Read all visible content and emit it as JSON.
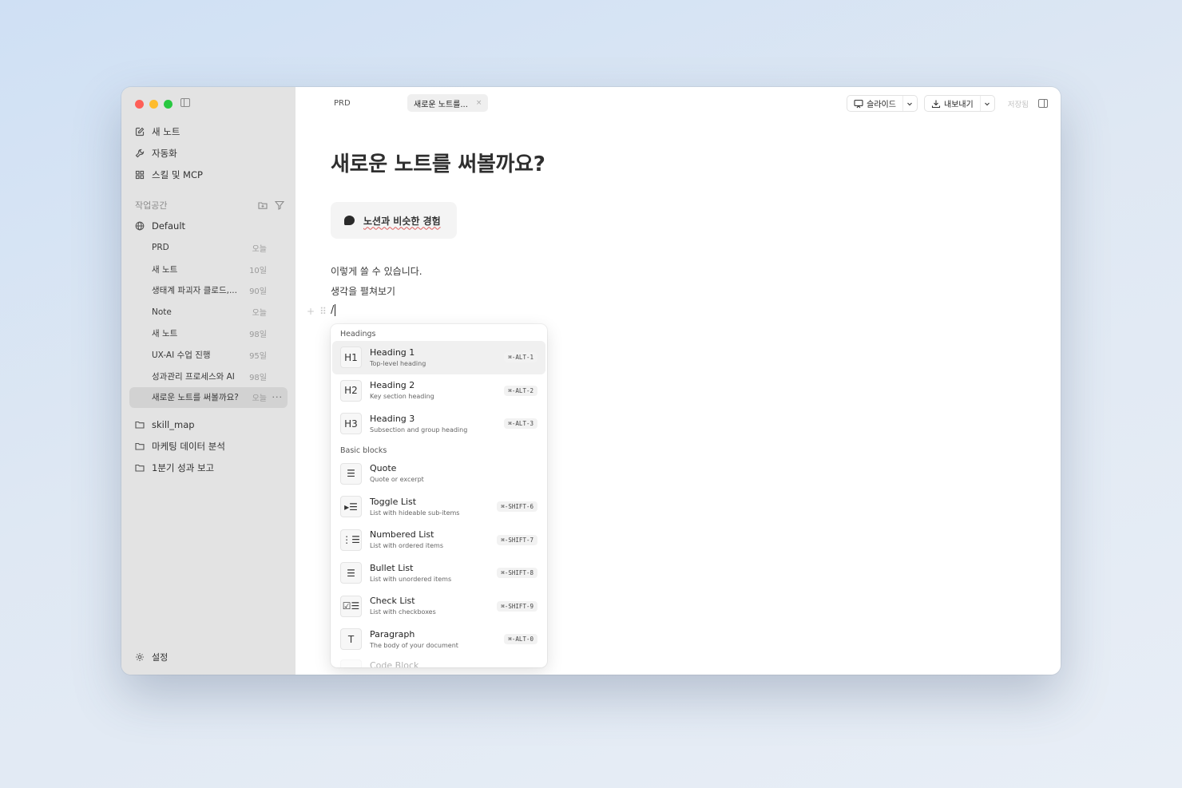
{
  "sidebar": {
    "nav": [
      {
        "label": "새 노트",
        "icon": "edit-icon"
      },
      {
        "label": "자동화",
        "icon": "wrench-icon"
      },
      {
        "label": "스킬 및 MCP",
        "icon": "grid-icon"
      }
    ],
    "section_label": "작업공간",
    "workspace": {
      "label": "Default",
      "icon": "globe-icon"
    },
    "docs": [
      {
        "title": "PRD",
        "date": "오늘"
      },
      {
        "title": "새 노트",
        "date": "10일"
      },
      {
        "title": "생태계 파괴자 클로드,...",
        "date": "90일"
      },
      {
        "title": "Note",
        "date": "오늘"
      },
      {
        "title": "새 노트",
        "date": "98일"
      },
      {
        "title": "UX-AI 수업 진행",
        "date": "95일"
      },
      {
        "title": "성과관리 프로세스와 AI",
        "date": "98일"
      },
      {
        "title": "새로운 노트를 써볼까요?",
        "date": "오늘"
      }
    ],
    "more_glyph": "···",
    "folders": [
      {
        "label": "skill_map"
      },
      {
        "label": "마케팅 데이터 분석"
      },
      {
        "label": "1분기 성과 보고"
      }
    ],
    "settings_label": "설정"
  },
  "tabs": {
    "inactive_label": "PRD",
    "active_label": "새로운 노트를...",
    "close_glyph": "×"
  },
  "toolbar": {
    "slide_label": "슬라이드",
    "export_label": "내보내기",
    "save_status": "저장됨"
  },
  "editor": {
    "title": "새로운 노트를 써볼까요?",
    "callout_text": "노션과 비슷한 경험",
    "line1": "이렇게 쓸 수 있습니다.",
    "line2": "생각을 펼쳐보기",
    "slash_input": "/",
    "add_glyph": "+",
    "drag_glyph": "⠿"
  },
  "slash_menu": {
    "section_headings": "Headings",
    "section_basic": "Basic blocks",
    "headings": [
      {
        "icon": "H1",
        "title": "Heading 1",
        "sub": "Top-level heading",
        "shortcut": "⌘-ALT-1"
      },
      {
        "icon": "H2",
        "title": "Heading 2",
        "sub": "Key section heading",
        "shortcut": "⌘-ALT-2"
      },
      {
        "icon": "H3",
        "title": "Heading 3",
        "sub": "Subsection and group heading",
        "shortcut": "⌘-ALT-3"
      }
    ],
    "basic": [
      {
        "icon": "quote-icon",
        "glyph": "☰",
        "title": "Quote",
        "sub": "Quote or excerpt",
        "shortcut": ""
      },
      {
        "icon": "toggle-list-icon",
        "glyph": "▸☰",
        "title": "Toggle List",
        "sub": "List with hideable sub-items",
        "shortcut": "⌘-SHIFT-6"
      },
      {
        "icon": "numbered-list-icon",
        "glyph": "⋮☰",
        "title": "Numbered List",
        "sub": "List with ordered items",
        "shortcut": "⌘-SHIFT-7"
      },
      {
        "icon": "bullet-list-icon",
        "glyph": "☰",
        "title": "Bullet List",
        "sub": "List with unordered items",
        "shortcut": "⌘-SHIFT-8"
      },
      {
        "icon": "check-list-icon",
        "glyph": "☑☰",
        "title": "Check List",
        "sub": "List with checkboxes",
        "shortcut": "⌘-SHIFT-9"
      },
      {
        "icon": "paragraph-icon",
        "glyph": "T",
        "title": "Paragraph",
        "sub": "The body of your document",
        "shortcut": "⌘-ALT-0"
      }
    ],
    "partial_item": {
      "title": "Code Block"
    }
  }
}
